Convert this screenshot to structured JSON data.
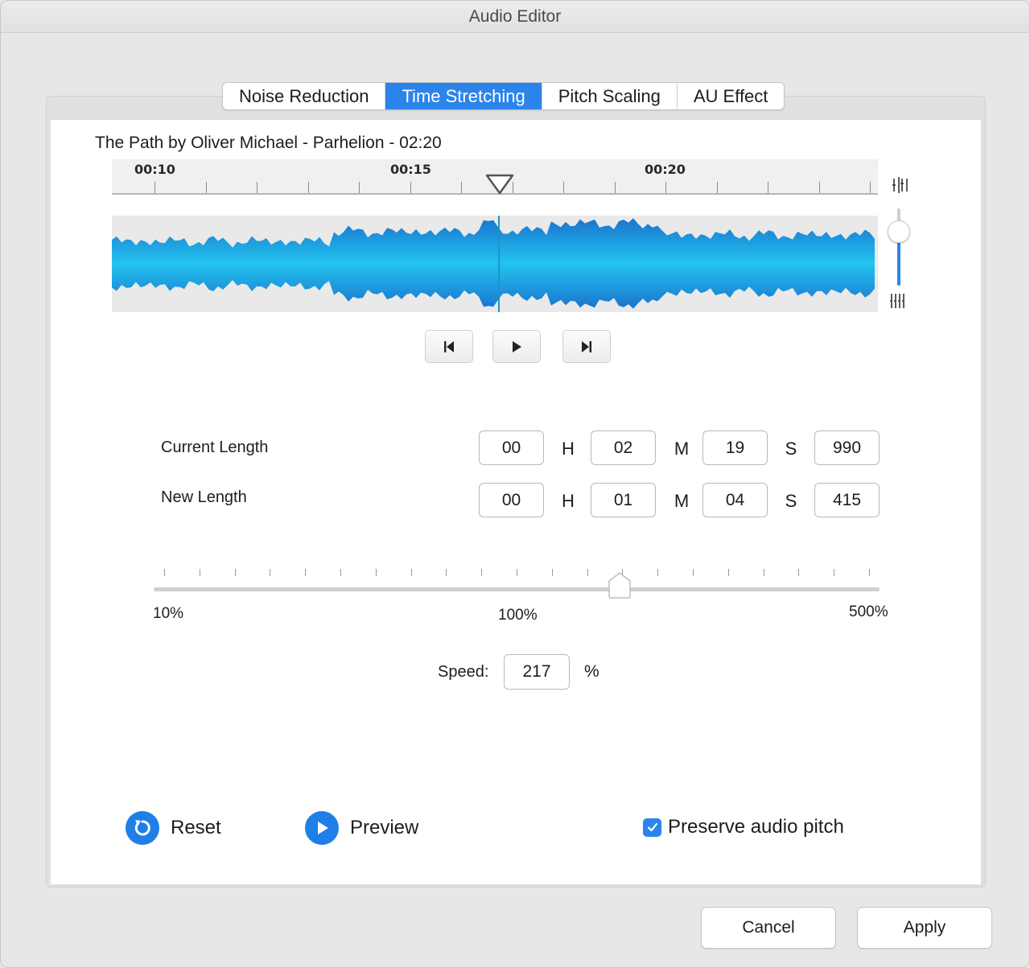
{
  "window": {
    "title": "Audio Editor"
  },
  "tabs": [
    {
      "label": "Noise Reduction",
      "active": false
    },
    {
      "label": "Time Stretching",
      "active": true
    },
    {
      "label": "Pitch Scaling",
      "active": false
    },
    {
      "label": "AU Effect",
      "active": false
    }
  ],
  "track": {
    "title": "The Path by Oliver Michael - Parhelion - 02:20",
    "ruler_labels": [
      "00:10",
      "00:15",
      "00:20"
    ]
  },
  "transport": {
    "icons": [
      "skip-to-start-icon",
      "play-icon",
      "skip-to-end-icon"
    ]
  },
  "zoom": {
    "icons": [
      "zoom-in-waveform-icon",
      "zoom-out-waveform-icon"
    ]
  },
  "length": {
    "current": {
      "label": "Current Length",
      "h": "00",
      "m": "02",
      "s": "19",
      "ms": "990"
    },
    "new": {
      "label": "New Length",
      "h": "00",
      "m": "01",
      "s": "04",
      "ms": "415"
    },
    "units": {
      "h": "H",
      "m": "M",
      "s": "S"
    }
  },
  "speed_slider": {
    "min_label": "10%",
    "mid_label": "100%",
    "max_label": "500%"
  },
  "speed": {
    "label": "Speed:",
    "value": "217",
    "unit": "%"
  },
  "actions": {
    "reset": "Reset",
    "preview": "Preview",
    "preserve_pitch": {
      "label": "Preserve audio pitch",
      "checked": true
    }
  },
  "buttons": {
    "cancel": "Cancel",
    "apply": "Apply"
  },
  "colors": {
    "accent": "#2b84ea",
    "waveform_outer": "#1a73cf",
    "waveform_inner": "#22c4ee"
  }
}
